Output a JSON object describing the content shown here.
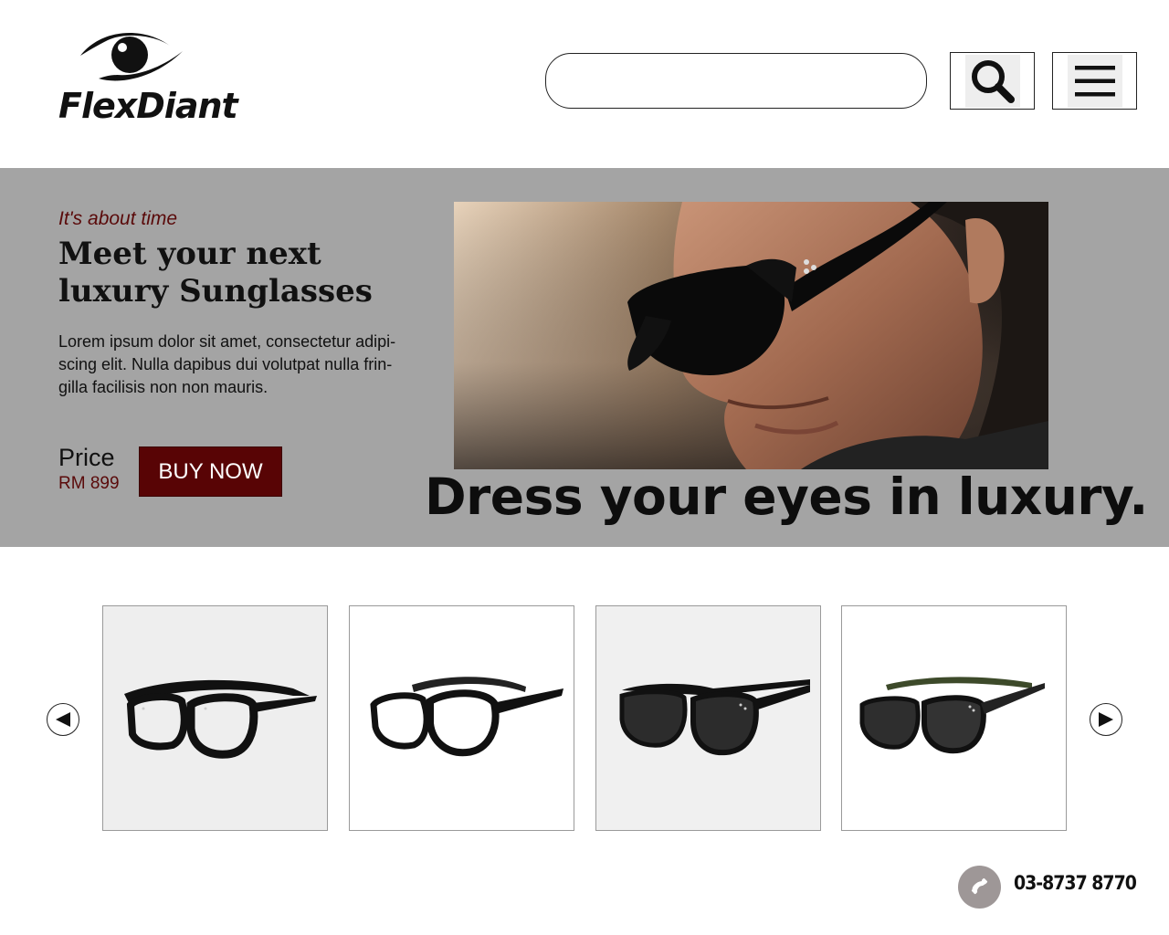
{
  "brand": {
    "name": "FlexDiant",
    "logo_icon": "eye-icon"
  },
  "header": {
    "search": {
      "value": "",
      "placeholder": ""
    },
    "search_button_icon": "search-icon",
    "menu_button_icon": "hamburger-menu-icon"
  },
  "hero": {
    "eyebrow": "It's about time",
    "title": "Meet your next luxury Sunglasses",
    "body": "Lorem ipsum dolor sit amet, consectetur adipi-scing elit. Nulla dapibus dui volutpat nulla frin-gilla facilisis non non mauris.",
    "price_label": "Price",
    "price_value": "RM 899",
    "cta_label": "BUY NOW",
    "tagline": "Dress your eyes in luxury."
  },
  "carousel": {
    "prev_icon": "triangle-left-icon",
    "next_icon": "triangle-right-icon",
    "products": [
      {
        "icon": "clear-eyeglasses-image"
      },
      {
        "icon": "clear-eyeglasses-image"
      },
      {
        "icon": "dark-sunglasses-image"
      },
      {
        "icon": "dark-sunglasses-image"
      }
    ]
  },
  "contact": {
    "phone_icon": "phone-icon",
    "phone": "03-8737 8770"
  },
  "colors": {
    "hero_background": "#a4a4a4",
    "accent": "#580405",
    "eyebrow": "#5a0a0a",
    "phone_badge": "#9e9797"
  }
}
